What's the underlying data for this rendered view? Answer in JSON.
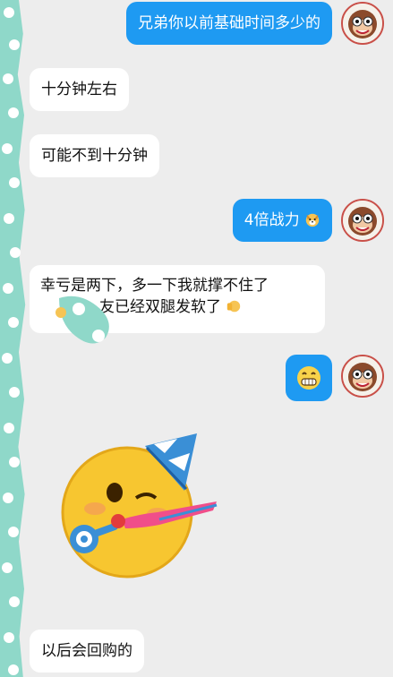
{
  "messages": [
    {
      "id": "m1",
      "side": "out",
      "text": "兄弟你以前基础时间多少的"
    },
    {
      "id": "m2",
      "side": "in",
      "text": "十分钟左右"
    },
    {
      "id": "m3",
      "side": "in",
      "text": "可能不到十分钟"
    },
    {
      "id": "m4",
      "side": "out",
      "text": "4倍战力"
    },
    {
      "id": "m5",
      "side": "in",
      "line1": "幸亏是两下，多一下我就撑不住了",
      "line2": "友已经双腿发软了"
    },
    {
      "id": "m6",
      "side": "out",
      "emoji": "grin-emoji"
    },
    {
      "id": "m7",
      "side": "in",
      "sticker": "party-face-sticker"
    },
    {
      "id": "m8",
      "side": "in",
      "text": "以后会回购的"
    }
  ],
  "colors": {
    "outgoing_bubble": "#1e9af2",
    "incoming_bubble": "#ffffff",
    "background": "#ededed",
    "side_strip": "#8fd8c9"
  }
}
